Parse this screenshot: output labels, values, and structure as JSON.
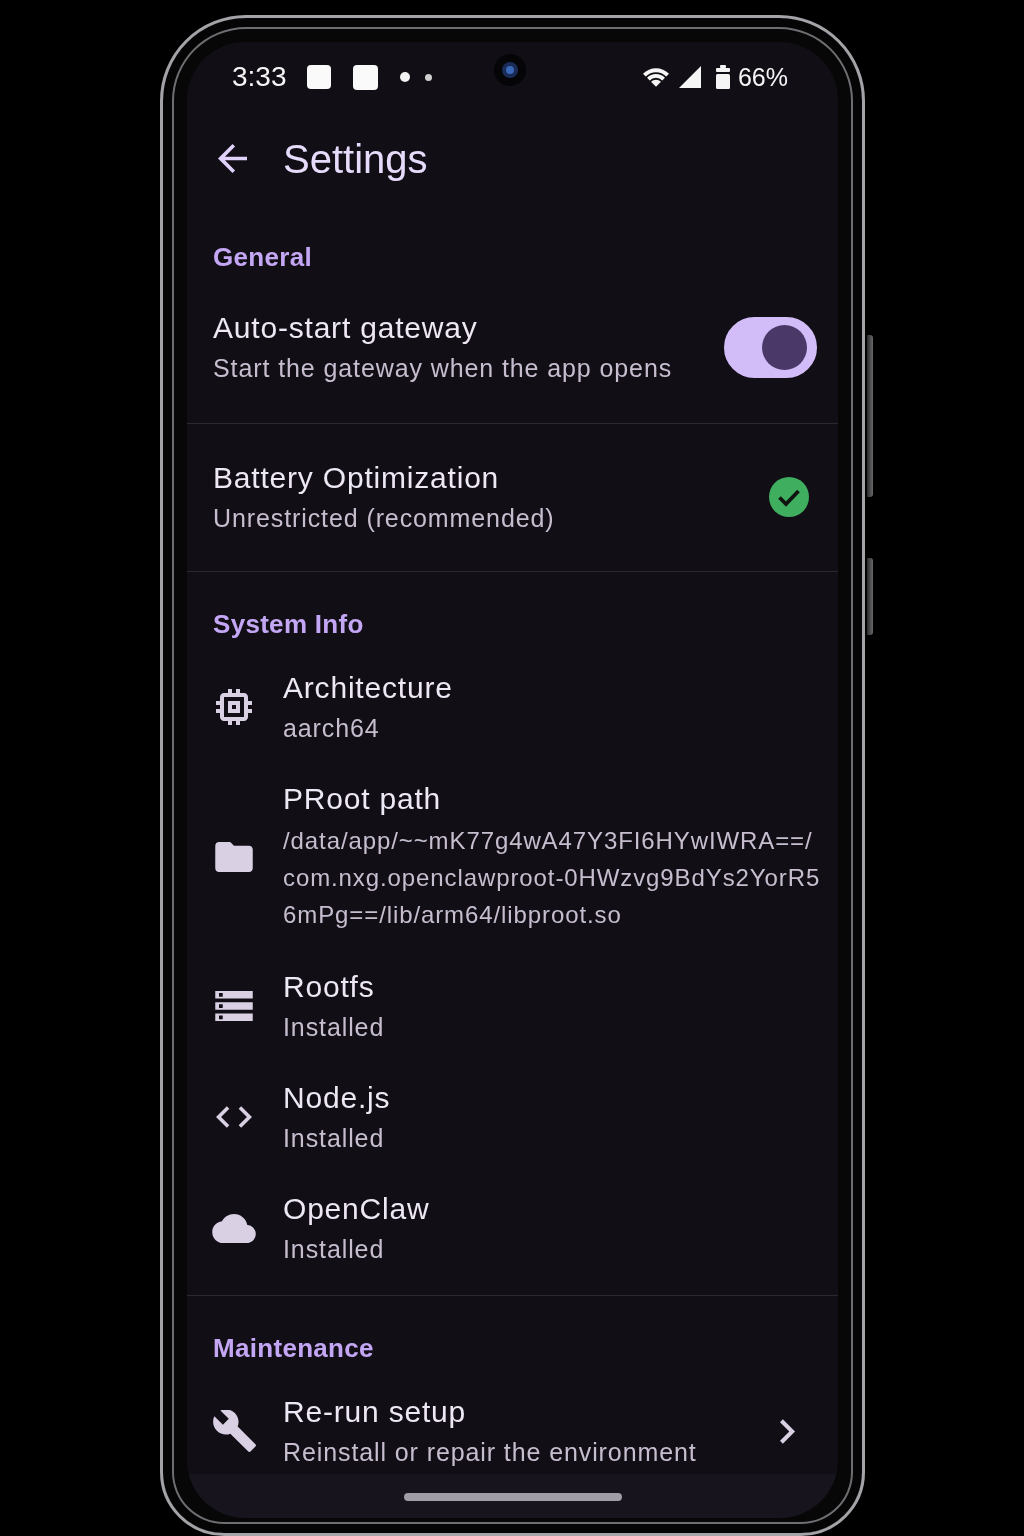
{
  "status_bar": {
    "time": "3:33",
    "battery": "66%"
  },
  "app_bar": {
    "title": "Settings"
  },
  "sections": [
    {
      "title": "General",
      "items": [
        {
          "kind": "switch",
          "title": "Auto-start gateway",
          "subtitle": "Start the gateway when the app opens",
          "on": true
        },
        {
          "kind": "status",
          "title": "Battery Optimization",
          "subtitle": "Unrestricted (recommended)",
          "ok": true
        }
      ]
    },
    {
      "title": "System Info",
      "items": [
        {
          "kind": "info",
          "title": "Architecture",
          "subtitle": "aarch64"
        },
        {
          "kind": "path",
          "title": "PRoot path",
          "lines": [
            "/data/app/~~mK77g4wA47Y3FI6HYwIWRA==/",
            "com.nxg.openclawproot-0HWzvg9BdYs2YorR5",
            "6mPg==/lib/arm64/libproot.so"
          ]
        },
        {
          "kind": "info",
          "title": "Rootfs",
          "subtitle": "Installed"
        },
        {
          "kind": "info",
          "title": "Node.js",
          "subtitle": "Installed"
        },
        {
          "kind": "info",
          "title": "OpenClaw",
          "subtitle": "Installed"
        }
      ]
    },
    {
      "title": "Maintenance",
      "items": [
        {
          "kind": "link",
          "title": "Re-run setup",
          "subtitle": "Reinstall or repair the environment"
        }
      ]
    }
  ]
}
